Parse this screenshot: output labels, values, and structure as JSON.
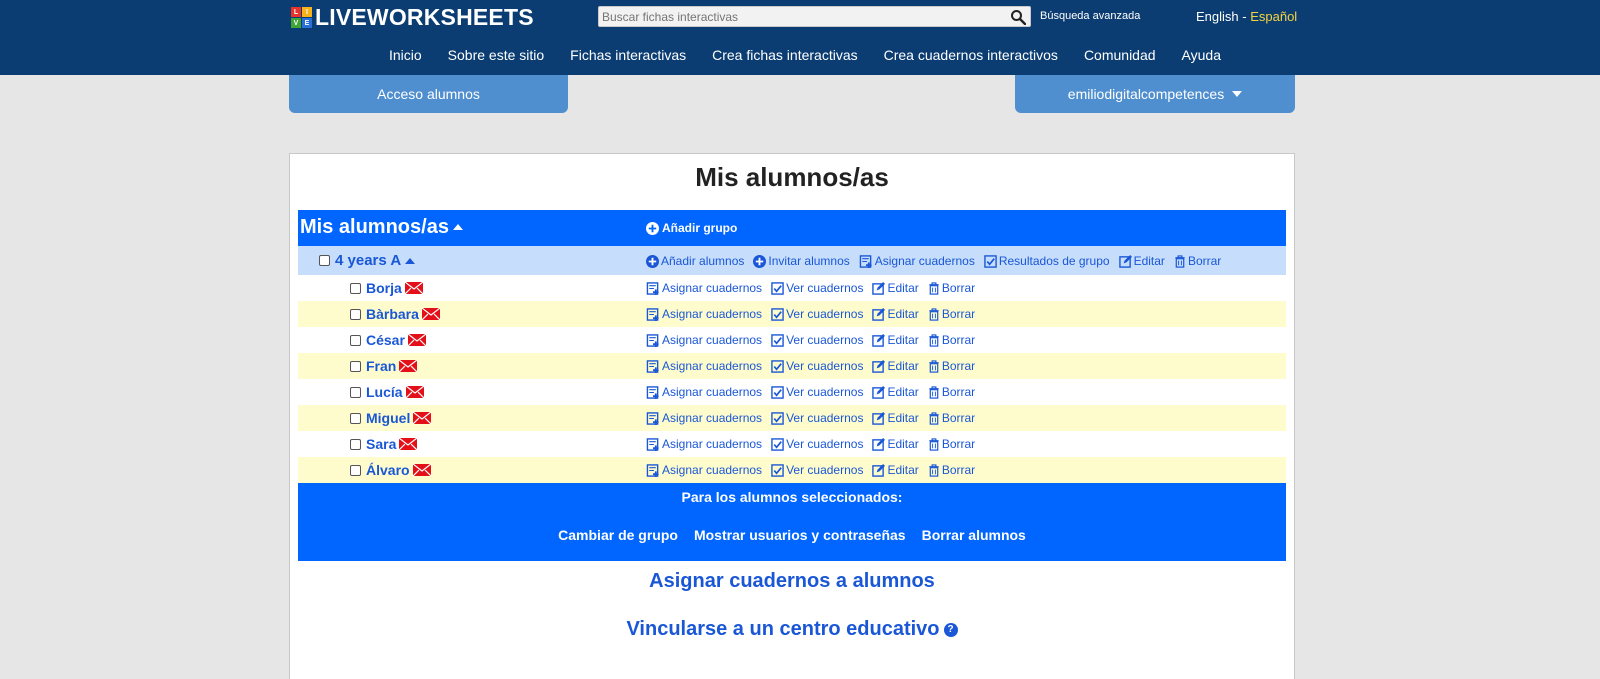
{
  "header": {
    "logo_letters": [
      "L",
      "I",
      "V",
      "E"
    ],
    "logo_text": "LIVEWORKSHEETS",
    "search_placeholder": "Buscar fichas interactivas",
    "advanced_search": "Búsqueda avanzada",
    "lang_english": "English",
    "lang_separator": " - ",
    "lang_spanish": "Español",
    "nav": [
      "Inicio",
      "Sobre este sitio",
      "Fichas interactivas",
      "Crea fichas interactivas",
      "Crea cuadernos interactivos",
      "Comunidad",
      "Ayuda"
    ]
  },
  "tabs": {
    "students_access": "Acceso alumnos",
    "user": "emiliodigitalcompetences"
  },
  "panel": {
    "title": "Mis alumnos/as",
    "table_title": "Mis alumnos/as",
    "add_group": "Añadir grupo",
    "group": {
      "name": "4 years A",
      "actions": [
        "Añadir alumnos",
        "Invitar alumnos",
        "Asignar cuadernos",
        "Resultados de grupo",
        "Editar",
        "Borrar"
      ]
    },
    "student_actions": [
      "Asignar cuadernos",
      "Ver cuadernos",
      "Editar",
      "Borrar"
    ],
    "students": [
      "Borja",
      "Bàrbara",
      "César",
      "Fran",
      "Lucía",
      "Miguel",
      "Sara",
      "Álvaro"
    ],
    "selected_label": "Para los alumnos seleccionados:",
    "bulk_actions": [
      "Cambiar de grupo",
      "Mostrar usuarios y contraseñas",
      "Borrar alumnos"
    ],
    "assign_link": "Asignar cuadernos a alumnos",
    "link_center": "Vincularse a un centro educativo",
    "help_glyph": "?"
  },
  "colors": {
    "header_bg": "#0b3d73",
    "tab_bg": "#4f8ecf",
    "table_header": "#0066ff",
    "group_row": "#c6defc",
    "alt_row": "#fefccd",
    "link": "#1a57d6",
    "mail_red": "#e3101a"
  }
}
